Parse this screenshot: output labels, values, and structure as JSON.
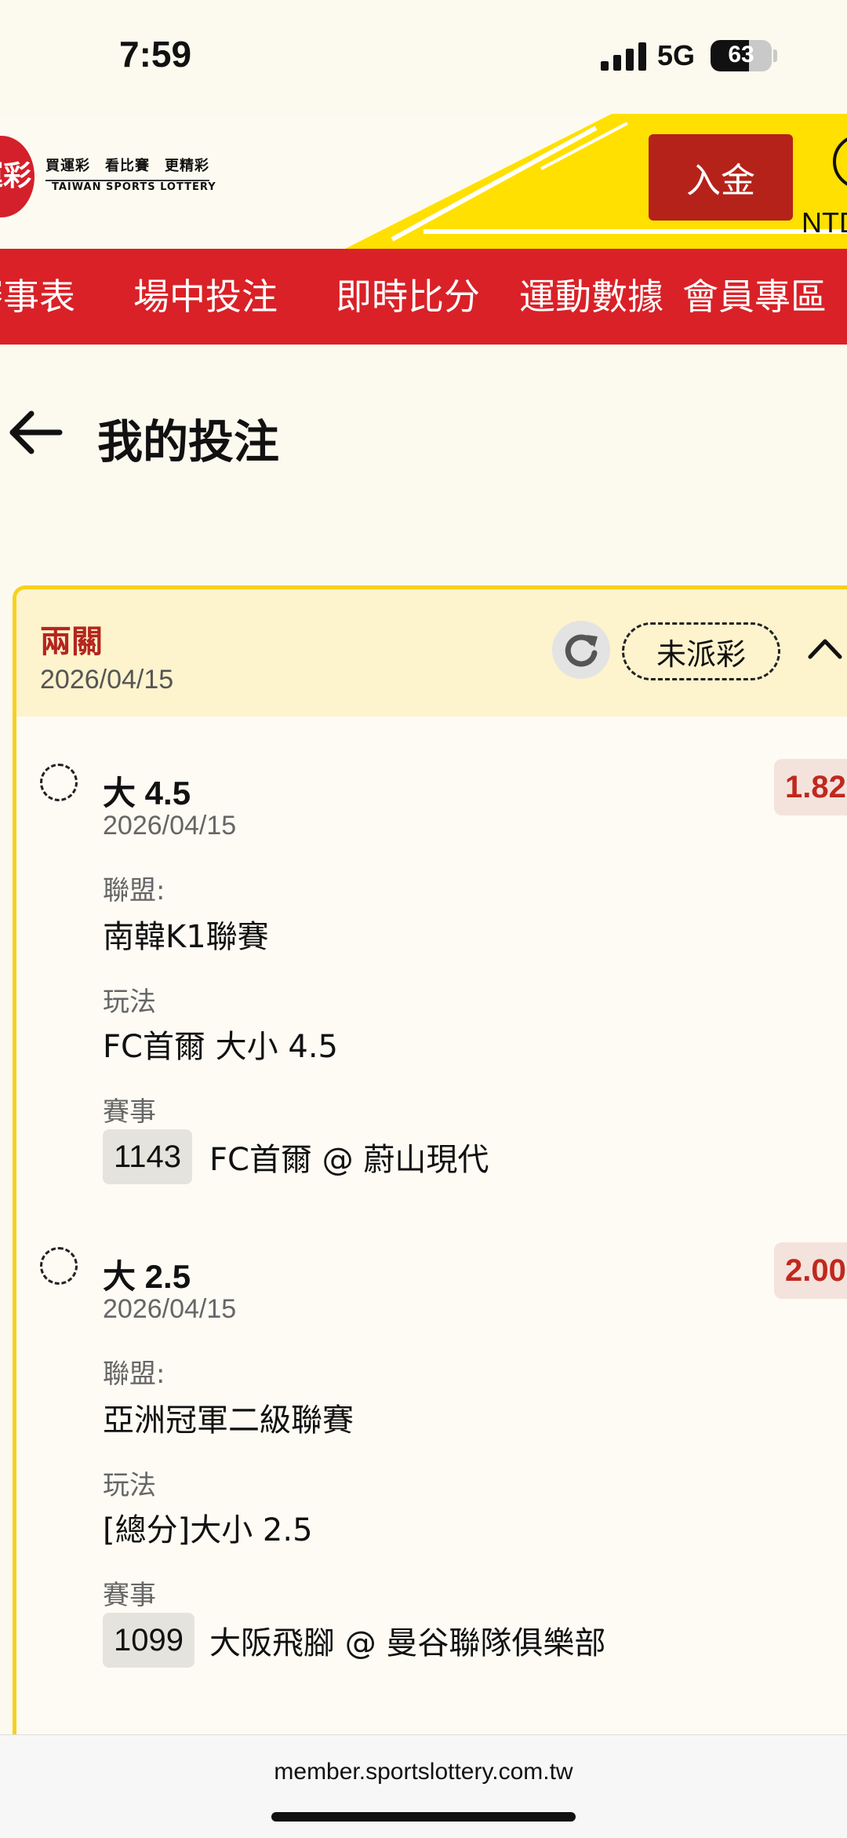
{
  "status_bar": {
    "time": "7:59",
    "network": "5G",
    "battery": "63",
    "battery_level": 0.63
  },
  "header": {
    "logo_text": "運彩",
    "logo_slogan": "買運彩　看比賽　更精彩",
    "logo_en": "TAIWAN SPORTS LOTTERY",
    "deposit_label": "入金",
    "currency_label": "NTD"
  },
  "nav": {
    "items": [
      {
        "label": "賽事表"
      },
      {
        "label": "場中投注"
      },
      {
        "label": "即時比分"
      },
      {
        "label": "運動數據"
      },
      {
        "label": "會員專區"
      }
    ]
  },
  "page": {
    "title": "我的投注"
  },
  "ticket": {
    "bet_type": "兩關",
    "date": "2026/04/15",
    "status": "未派彩",
    "legs": [
      {
        "pick": "大 4.5",
        "date": "2026/04/15",
        "odds": "1.82",
        "league_label": "聯盟:",
        "league": "南韓K1聯賽",
        "market_label": "玩法",
        "market": "FC首爾 大小 4.5",
        "match_label": "賽事",
        "match_code": "1143",
        "match": "FC首爾 @ 蔚山現代"
      },
      {
        "pick": "大 2.5",
        "date": "2026/04/15",
        "odds": "2.00",
        "league_label": "聯盟:",
        "league": "亞洲冠軍二級聯賽",
        "market_label": "玩法",
        "market": "[總分]大小 2.5",
        "match_label": "賽事",
        "match_code": "1099",
        "match": "大阪飛腳 @ 曼谷聯隊俱樂部"
      }
    ]
  },
  "browser": {
    "url": "member.sportslottery.com.tw"
  },
  "colors": {
    "brand_red": "#d92127",
    "accent_yellow": "#ffe000",
    "odds_red": "#c0281e"
  }
}
